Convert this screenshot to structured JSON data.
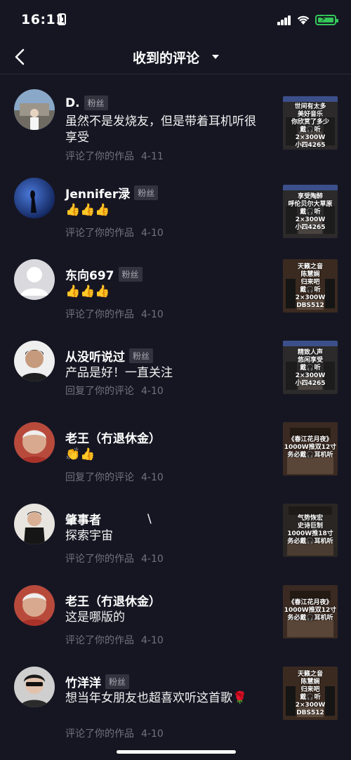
{
  "status_bar": {
    "time": "16:11"
  },
  "nav": {
    "title": "收到的评论"
  },
  "comments": [
    {
      "username": "D.",
      "badge": "粉丝",
      "text": "虽然不是发烧友，但是带着耳机听很享受",
      "action": "评论了你的作品",
      "date": "4-11",
      "thumb_lines": [
        "世间有太多",
        "美好音乐",
        "你欣赏了多少",
        "戴🎧听",
        "2×300W",
        "小四4265"
      ]
    },
    {
      "username": "Jennifer渌",
      "badge": "粉丝",
      "text": "👍👍👍",
      "action": "评论了你的作品",
      "date": "4-10",
      "thumb_lines": [
        "享受陶醉",
        "呼伦贝尔大草原",
        "戴🎧听",
        "2×300W",
        "小四4265"
      ]
    },
    {
      "username": "东向697",
      "badge": "粉丝",
      "text": "👍👍👍",
      "action": "评论了你的作品",
      "date": "4-10",
      "thumb_lines": [
        "天籁之音",
        "陈慧娴",
        "归来吧",
        "戴🎧听",
        "2×300W",
        "DBS512"
      ]
    },
    {
      "username": "从没听说过",
      "badge": "粉丝",
      "text": "产品是好！一直关注",
      "action": "回复了你的评论",
      "date": "4-10",
      "thumb_lines": [
        "精致人声",
        "悠闲享受",
        "戴🎧听",
        "2×300W",
        "小四4265"
      ]
    },
    {
      "username": "老王（冇退休金）",
      "badge": "",
      "text": "👏👍",
      "action": "回复了你的评论",
      "date": "4-10",
      "thumb_lines": [
        "《春江花月夜》",
        "1000W推双12寸",
        "务必戴🎧耳机听"
      ]
    },
    {
      "username": "肇事者",
      "badge": "",
      "extra": "\\",
      "text": "探索宇宙",
      "action": "评论了你的作品",
      "date": "4-10",
      "thumb_lines": [
        "气势恢宏",
        "史诗巨制",
        "1000W推18寸",
        "务必戴🎧耳机听"
      ]
    },
    {
      "username": "老王（冇退休金）",
      "badge": "",
      "text": "这是哪版的",
      "action": "评论了你的作品",
      "date": "4-10",
      "thumb_lines": [
        "《春江花月夜》",
        "1000W推双12寸",
        "务必戴🎧耳机听"
      ]
    },
    {
      "username": "竹洋洋",
      "badge": "粉丝",
      "text": "想当年女朋友也超喜欢听这首歌🌹",
      "action": "评论了你的作品",
      "date": "4-10",
      "thumb_lines": [
        "天籁之音",
        "陈慧娴",
        "归来吧",
        "戴🎧听",
        "2×300W",
        "DBS512"
      ]
    }
  ]
}
